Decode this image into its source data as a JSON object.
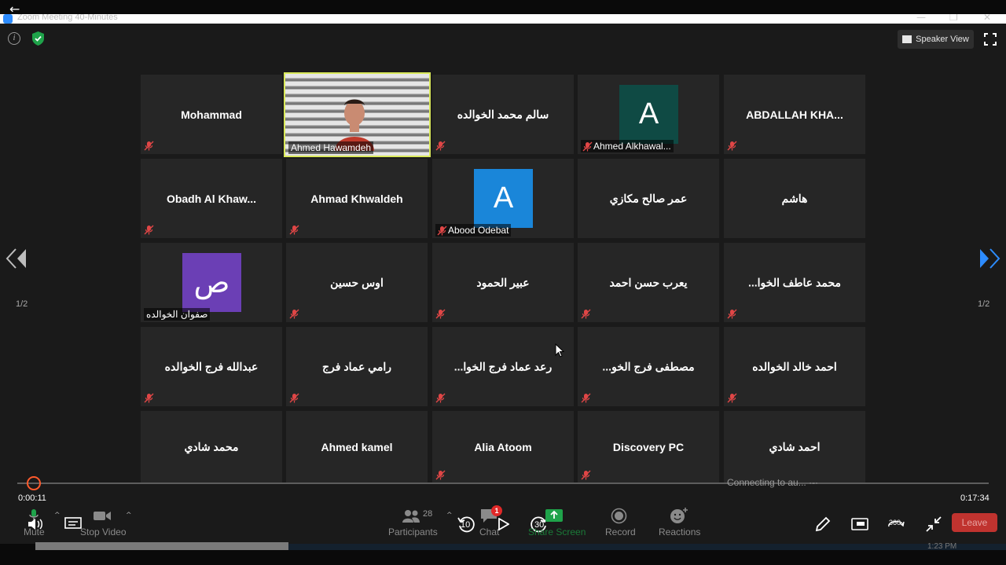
{
  "window": {
    "title": "Zoom Meeting 40-Minutes",
    "min": "—",
    "max": "❐",
    "close": "✕"
  },
  "topbar": {
    "speaker_view": "Speaker View"
  },
  "tiles": [
    {
      "name": "Mohammad",
      "muted": true
    },
    {
      "name": "Ahmed Hawamdeh",
      "video": true,
      "muted": false
    },
    {
      "name": "سالم محمد الخوالده",
      "muted": true
    },
    {
      "name": "Ahmed Alkhawal...",
      "avatar_letter": "A",
      "avatar_color": "#0f4a44",
      "muted": true
    },
    {
      "name": "ABDALLAH KHA...",
      "muted": true
    },
    {
      "name": "Obadh Al Khaw...",
      "muted": true
    },
    {
      "name": "Ahmad Khwaldeh",
      "muted": true
    },
    {
      "name": "Abood Odebat",
      "avatar_letter": "A",
      "avatar_color": "#1a86d9",
      "muted": true
    },
    {
      "name": "عمر صالح مكازي",
      "muted": false
    },
    {
      "name": "هاشم",
      "muted": false
    },
    {
      "name": "صفوان الخوالده",
      "avatar_letter": "ص",
      "avatar_color": "#6b3fb5",
      "muted": false
    },
    {
      "name": "اوس حسين",
      "muted": true
    },
    {
      "name": "عبير الحمود",
      "muted": true
    },
    {
      "name": "يعرب حسن احمد",
      "muted": true
    },
    {
      "name": "...محمد عاطف الخوا",
      "muted": true
    },
    {
      "name": "عبدالله فرج الخوالده",
      "muted": true
    },
    {
      "name": "رامي عماد فرج",
      "muted": true
    },
    {
      "name": "...رعد عماد فرج الخوا",
      "muted": true
    },
    {
      "name": "...مصطفى فرج الخو",
      "muted": true
    },
    {
      "name": "احمد خالد الخوالده",
      "muted": true
    },
    {
      "name": "محمد شادي",
      "muted": false
    },
    {
      "name": "Ahmed kamel",
      "muted": false
    },
    {
      "name": "Alia Atoom",
      "muted": true
    },
    {
      "name": "Discovery PC",
      "muted": true
    },
    {
      "name": "احمد شادي",
      "muted": false
    }
  ],
  "pagination": {
    "left": "1/2",
    "right": "1/2"
  },
  "playback": {
    "current": "0:00:11",
    "total": "0:17:34",
    "progress_fraction": 0.01,
    "connecting": "Connecting to au... ·-·"
  },
  "toolbar": {
    "mute": "Mute",
    "stop_video": "Stop Video",
    "participants": "Participants",
    "participants_count": "28",
    "chat": "Chat",
    "chat_badge": "1",
    "share_screen": "Share Screen",
    "record": "Record",
    "reactions": "Reactions",
    "rewind": "10",
    "forward": "30",
    "leave": "Leave",
    "deg360": "360"
  },
  "taskbar": {
    "clock": "1:23 PM"
  }
}
